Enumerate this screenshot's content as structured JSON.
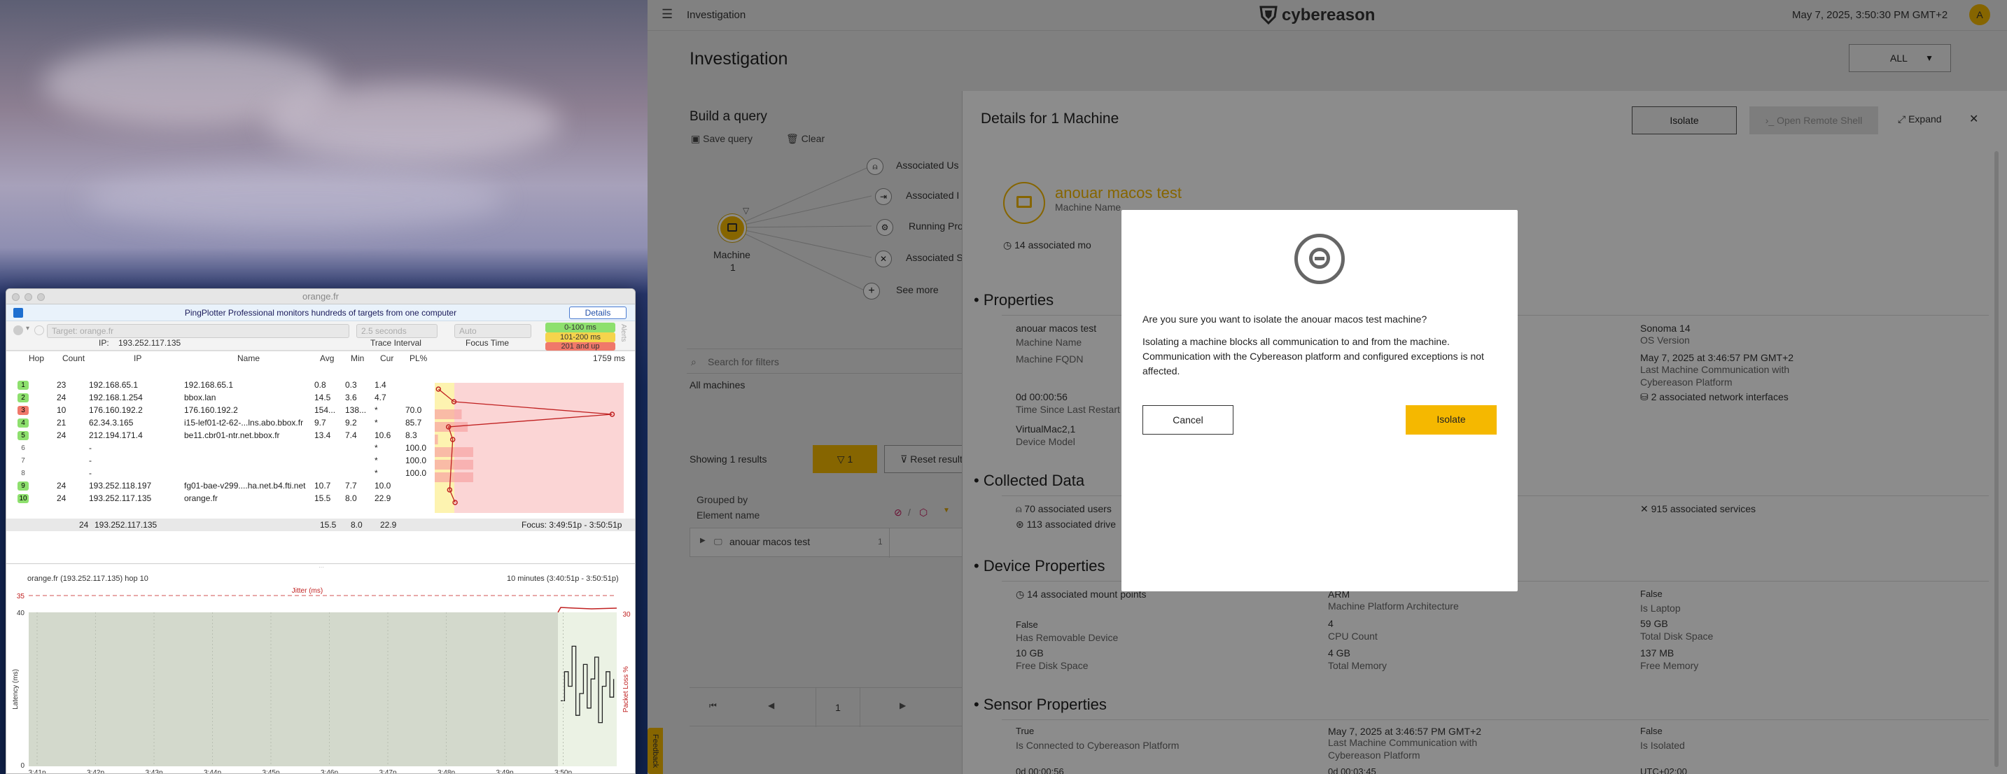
{
  "pingplotter": {
    "window_title": "orange.fr",
    "banner_text": "PingPlotter Professional monitors hundreds of targets from one computer",
    "details_label": "Details",
    "target_label": "Target:",
    "target_value": "orange.fr",
    "interval_value": "2.5 seconds",
    "focus_value": "Auto",
    "ip_label": "IP:",
    "ip_value": "193.252.117.135",
    "trace_interval_label": "Trace Interval",
    "focus_time_label": "Focus Time",
    "legend": [
      {
        "label": "0-100 ms",
        "color": "#8ee06e"
      },
      {
        "label": "101-200 ms",
        "color": "#f5d44c"
      },
      {
        "label": "201 and up",
        "color": "#f0786a"
      }
    ],
    "alerts_label": "Alerts",
    "columns": [
      "Hop",
      "Count",
      "IP",
      "Name",
      "Avg",
      "Min",
      "Cur",
      "PL%"
    ],
    "scale_label": "1759 ms",
    "hops": [
      {
        "hop": "1",
        "count": "23",
        "ip": "192.168.65.1",
        "name": "192.168.65.1",
        "avg": "0.8",
        "min": "0.3",
        "cur": "1.4",
        "pl": "",
        "color": "#8ee06e"
      },
      {
        "hop": "2",
        "count": "24",
        "ip": "192.168.1.254",
        "name": "bbox.lan",
        "avg": "14.5",
        "min": "3.6",
        "cur": "4.7",
        "pl": "",
        "color": "#8ee06e"
      },
      {
        "hop": "3",
        "count": "10",
        "ip": "176.160.192.2",
        "name": "176.160.192.2",
        "avg": "154...",
        "min": "138...",
        "cur": "*",
        "pl": "70.0",
        "color": "#f0786a"
      },
      {
        "hop": "4",
        "count": "21",
        "ip": "62.34.3.165",
        "name": "i15-lef01-t2-62-...lns.abo.bbox.fr",
        "avg": "9.7",
        "min": "9.2",
        "cur": "*",
        "pl": "85.7",
        "color": "#8ee06e"
      },
      {
        "hop": "5",
        "count": "24",
        "ip": "212.194.171.4",
        "name": "be11.cbr01-ntr.net.bbox.fr",
        "avg": "13.4",
        "min": "7.4",
        "cur": "10.6",
        "pl": "8.3",
        "color": "#8ee06e"
      },
      {
        "hop": "6",
        "count": "",
        "ip": "-",
        "name": "",
        "avg": "",
        "min": "",
        "cur": "*",
        "pl": "100.0",
        "color": ""
      },
      {
        "hop": "7",
        "count": "",
        "ip": "-",
        "name": "",
        "avg": "",
        "min": "",
        "cur": "*",
        "pl": "100.0",
        "color": ""
      },
      {
        "hop": "8",
        "count": "",
        "ip": "-",
        "name": "",
        "avg": "",
        "min": "",
        "cur": "*",
        "pl": "100.0",
        "color": ""
      },
      {
        "hop": "9",
        "count": "24",
        "ip": "193.252.118.197",
        "name": "fg01-bae-v299....ha.net.b4.fti.net",
        "avg": "10.7",
        "min": "7.7",
        "cur": "10.0",
        "pl": "",
        "color": "#8ee06e"
      },
      {
        "hop": "10",
        "count": "24",
        "ip": "193.252.117.135",
        "name": "orange.fr",
        "avg": "15.5",
        "min": "8.0",
        "cur": "22.9",
        "pl": "",
        "color": "#8ee06e"
      }
    ],
    "summary_row": {
      "count": "24",
      "ip": "193.252.117.135",
      "avg": "15.5",
      "min": "8.0",
      "cur": "22.9",
      "focus": "Focus: 3:49:51p - 3:50:51p"
    },
    "graph_title": "orange.fr (193.252.117.135) hop 10",
    "graph_range": "10 minutes (3:40:51p - 3:50:51p)",
    "jitter_label": "Jitter (ms)",
    "y_axis_label": "Latency (ms)",
    "y2_axis_label": "Packet Loss %",
    "y_ticks": [
      "35",
      "40",
      "0"
    ],
    "y2_tick": "30",
    "x_ticks": [
      "3:41p",
      "3:42p",
      "3:43p",
      "3:44p",
      "3:45p",
      "3:46p",
      "3:47p",
      "3:48p",
      "3:49p",
      "3:50p"
    ]
  },
  "app": {
    "topbar_section": "Investigation",
    "brand": "cybereason",
    "datetime": "May 7, 2025, 3:50:30 PM GMT+2",
    "avatar_letter": "A",
    "page_title": "Investigation",
    "scope_select": "ALL",
    "build_query_title": "Build a query",
    "save_query": "Save query",
    "clear": "Clear",
    "machine_node_label": "Machine",
    "machine_node_count": "1",
    "assoc_items": [
      "Associated Us",
      "Associated I",
      "Running Pro",
      "Associated S",
      "See more"
    ],
    "search_filters_placeholder": "Search for filters",
    "all_machines": "All machines",
    "showing_results": "Showing 1 results",
    "filter_count": "1",
    "reset_results": "Reset results",
    "grouped_by_label": "Grouped by",
    "element_name_label": "Element name",
    "result_row_name": "anouar macos test",
    "result_row_count": "1",
    "page_number": "1",
    "feedback_tab": "Feedback"
  },
  "details": {
    "title": "Details for 1 Machine",
    "isolate_button": "Isolate",
    "remote_shell_button": "Open Remote Shell",
    "expand_button": "Expand",
    "machine_name": "anouar macos test",
    "machine_name_label": "Machine Name",
    "mount_points_summary": "14 associated mo",
    "properties_title": "Properties",
    "properties": [
      {
        "value": "anouar macos test",
        "label": "Machine Name"
      },
      {
        "value": "",
        "label": "Machine FQDN"
      },
      {
        "value": "0d 00:00:56",
        "label": "Time Since Last Restart"
      },
      {
        "value": "VirtualMac2,1",
        "label": "Device Model"
      }
    ],
    "properties_right": [
      {
        "value": "Sonoma 14",
        "label": "OS Version"
      },
      {
        "value": "May 7, 2025 at 3:46:57 PM GMT+2",
        "label": "Last Machine Communication with Cybereason Platform"
      },
      {
        "value": "2 associated network interfaces",
        "label": ""
      }
    ],
    "collected_title": "Collected Data",
    "collected": [
      "70 associated users",
      "113 associated drive",
      "915 associated services"
    ],
    "device_title": "Device Properties",
    "device_mount": "14 associated mount points",
    "device_props": [
      {
        "value": "ARM",
        "label": "Machine Platform Architecture"
      },
      {
        "value": "False",
        "label": "Is Laptop"
      },
      {
        "value": "False",
        "label": "Has Removable Device"
      },
      {
        "value": "4",
        "label": "CPU Count"
      },
      {
        "value": "59 GB",
        "label": "Total Disk Space"
      },
      {
        "value": "10 GB",
        "label": "Free Disk Space"
      },
      {
        "value": "4 GB",
        "label": "Total Memory"
      },
      {
        "value": "137 MB",
        "label": "Free Memory"
      }
    ],
    "sensor_title": "Sensor Properties",
    "sensor_props": [
      {
        "value": "True",
        "label": "Is Connected to Cybereason Platform"
      },
      {
        "value": "May 7, 2025 at 3:46:57 PM GMT+2",
        "label": "Last Machine Communication with Cybereason Platform"
      },
      {
        "value": "False",
        "label": "Is Isolated"
      }
    ],
    "sensor_bottom": [
      "0d 00:00:56",
      "0d 00:03:45",
      "UTC+02:00"
    ]
  },
  "modal": {
    "question": "Are you sure you want to isolate the anouar macos test machine?",
    "body": "Isolating a machine blocks all communication to and from the machine. Communication with the Cybereason platform and configured exceptions is not affected.",
    "cancel": "Cancel",
    "confirm": "Isolate"
  },
  "colors": {
    "accent": "#f5b800",
    "plot_bg": "#d3d9cc",
    "loss_red": "#cc2020"
  }
}
